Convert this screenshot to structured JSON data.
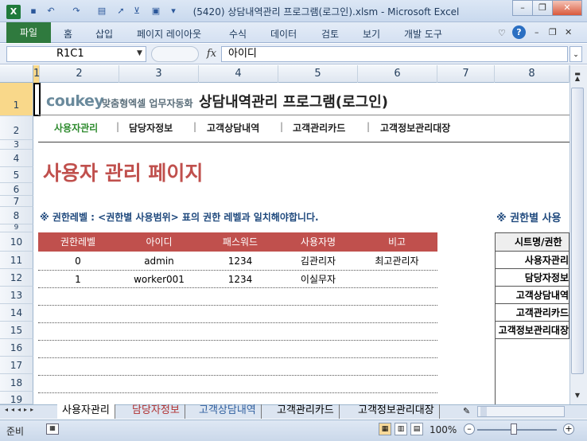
{
  "window": {
    "title": "(5420) 상담내역관리 프로그램(로그인).xlsm  -  Microsoft Excel",
    "app_icon": "excel-icon"
  },
  "ribbon": {
    "file_tab": "파일",
    "tabs": [
      "홈",
      "삽입",
      "페이지 레이아웃",
      "수식",
      "데이터",
      "검토",
      "보기",
      "개발 도구"
    ]
  },
  "formula_bar": {
    "name_box": "R1C1",
    "fx": "fx",
    "content": "아이디"
  },
  "columns": [
    "1",
    "2",
    "3",
    "4",
    "5",
    "6",
    "7",
    "8"
  ],
  "rows": [
    "1",
    "2",
    "3",
    "4",
    "5",
    "6",
    "7",
    "8",
    "9",
    "10",
    "11",
    "12",
    "13",
    "14",
    "15",
    "16",
    "17",
    "18",
    "19"
  ],
  "sheet": {
    "logo": "coukey",
    "logo_sub": "맞춤형엑셀 업무자동화",
    "app_title": "상담내역관리 프로그램(로그인)",
    "nav": [
      "사용자관리",
      "담당자정보",
      "고객상담내역",
      "고객관리카드",
      "고객정보관리대장"
    ],
    "nav_active_color": "#2e8b2e",
    "page_title": "사용자 관리 페이지",
    "note_left": "※ 권한레벨 : <권한별 사용범위> 표의 권한 레벨과 일치해야합니다.",
    "note_right": "※ 권한별 사용",
    "table": {
      "headers": [
        "권한레벨",
        "아이디",
        "패스워드",
        "사용자명",
        "비고"
      ],
      "rows": [
        [
          "0",
          "admin",
          "1234",
          "김관리자",
          "최고관리자"
        ],
        [
          "1",
          "worker001",
          "1234",
          "이실무자",
          ""
        ]
      ],
      "header_color": "#c0504d"
    },
    "right_table": {
      "header": "시트명/권한",
      "rows": [
        "사용자관리",
        "담당자정보",
        "고객상담내역",
        "고객관리카드",
        "고객정보관리대장"
      ]
    }
  },
  "sheet_tabs": [
    "사용자관리",
    "담당자정보",
    "고객상담내역",
    "고객관리카드",
    "고객정보관리대장"
  ],
  "status": {
    "ready": "준비",
    "zoom": "100%"
  }
}
